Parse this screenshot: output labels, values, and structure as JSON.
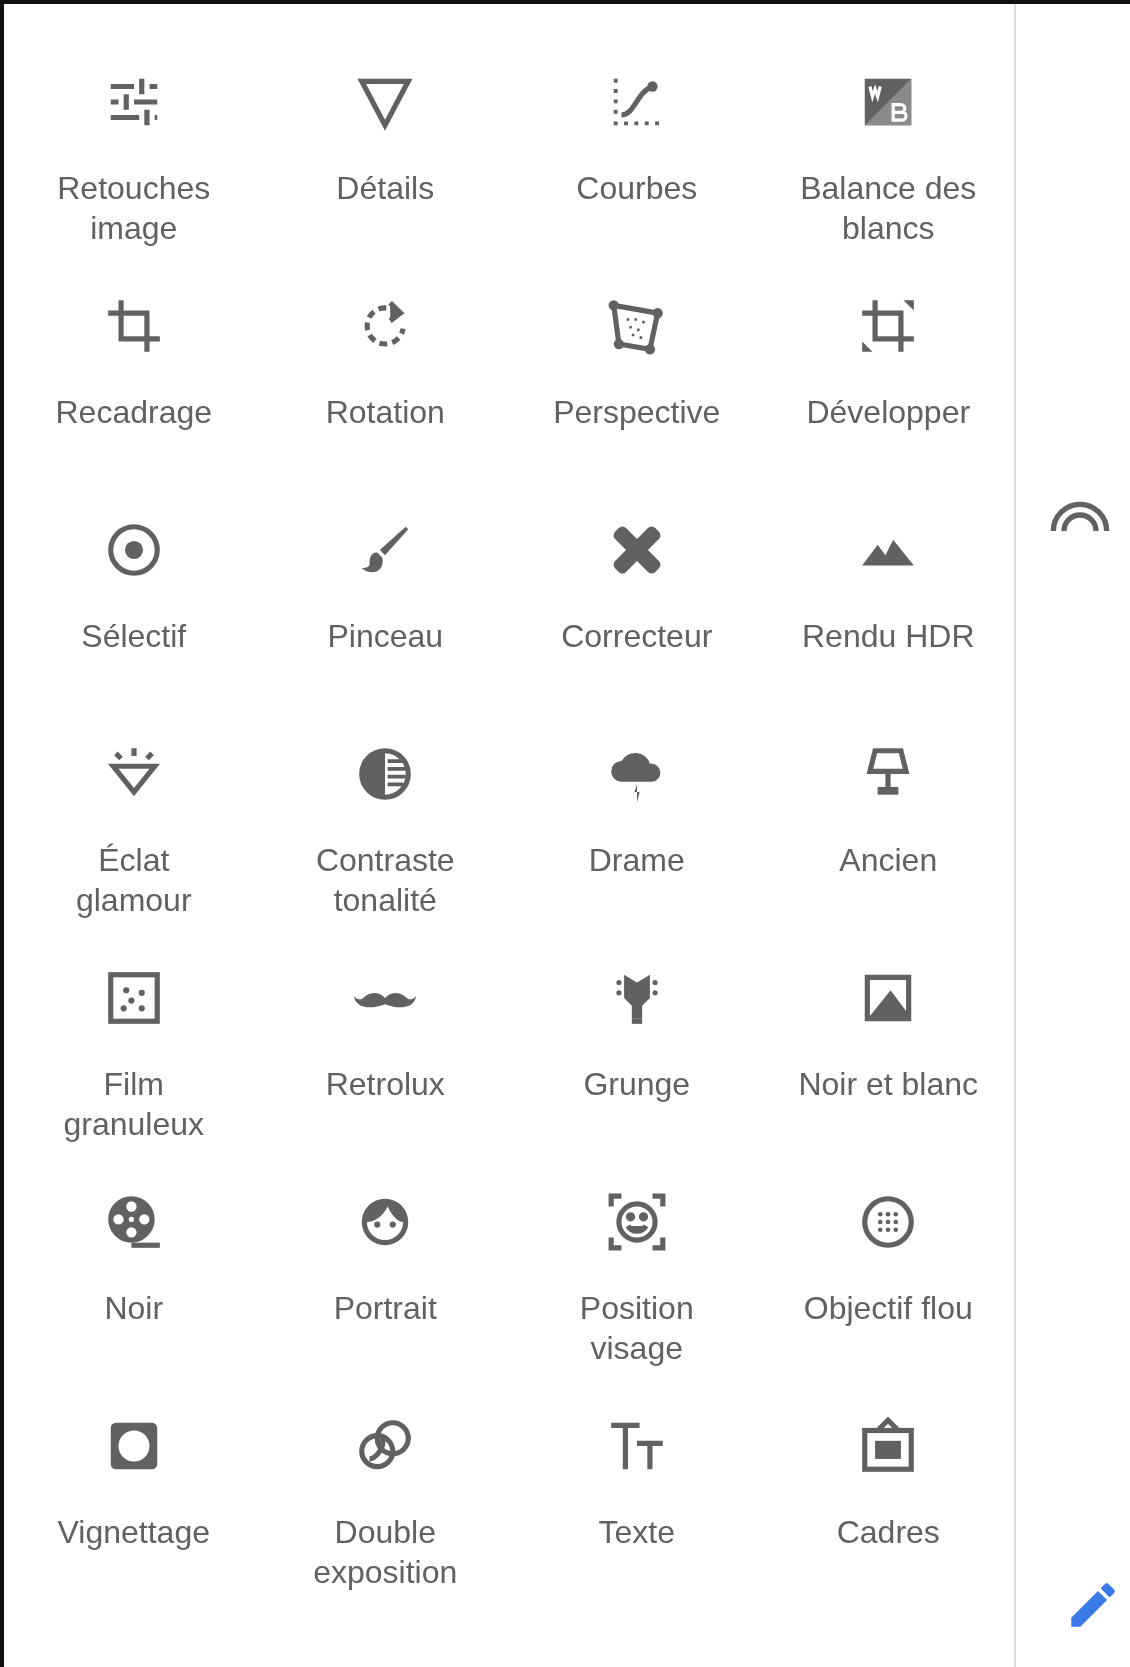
{
  "tools": [
    {
      "label": "Retouches\nimage"
    },
    {
      "label": "Détails"
    },
    {
      "label": "Courbes"
    },
    {
      "label": "Balance des\nblancs"
    },
    {
      "label": "Recadrage"
    },
    {
      "label": "Rotation"
    },
    {
      "label": "Perspective"
    },
    {
      "label": "Développer"
    },
    {
      "label": "Sélectif"
    },
    {
      "label": "Pinceau"
    },
    {
      "label": "Correcteur"
    },
    {
      "label": "Rendu HDR"
    },
    {
      "label": "Éclat\nglamour"
    },
    {
      "label": "Contraste\ntonalité"
    },
    {
      "label": "Drame"
    },
    {
      "label": "Ancien"
    },
    {
      "label": "Film\ngranuleux"
    },
    {
      "label": "Retrolux"
    },
    {
      "label": "Grunge"
    },
    {
      "label": "Noir et blanc"
    },
    {
      "label": "Noir"
    },
    {
      "label": "Portrait"
    },
    {
      "label": "Position\nvisage"
    },
    {
      "label": "Objectif flou"
    },
    {
      "label": "Vignettage"
    },
    {
      "label": "Double\nexposition"
    },
    {
      "label": "Texte"
    },
    {
      "label": "Cadres"
    }
  ]
}
